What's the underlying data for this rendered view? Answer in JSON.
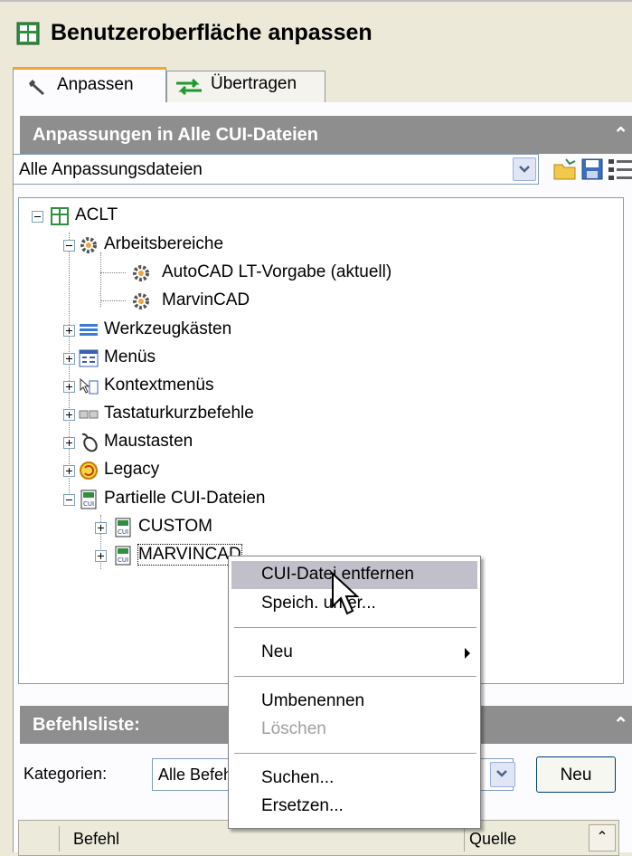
{
  "window": {
    "title": "Benutzeroberfläche anpassen"
  },
  "tabs": [
    {
      "label": "Anpassen",
      "active": true,
      "icon": "wrench-icon"
    },
    {
      "label": "Übertragen",
      "active": false,
      "icon": "transfer-arrows-icon"
    }
  ],
  "customizations": {
    "header": "Anpassungen in Alle CUI-Dateien",
    "file_filter": {
      "selected": "Alle Anpassungsdateien"
    },
    "tree": {
      "root": "ACLT",
      "workspaces": {
        "label": "Arbeitsbereiche",
        "children": [
          "AutoCAD LT-Vorgabe (aktuell)",
          "MarvinCAD"
        ]
      },
      "items": [
        {
          "label": "Werkzeugkästen",
          "icon": "toolbar-icon"
        },
        {
          "label": "Menüs",
          "icon": "menu-icon"
        },
        {
          "label": "Kontextmenüs",
          "icon": "context-menu-icon"
        },
        {
          "label": "Tastaturkurzbefehle",
          "icon": "keyboard-keys-icon"
        },
        {
          "label": "Maustasten",
          "icon": "mouse-icon"
        },
        {
          "label": "Legacy",
          "icon": "legacy-icon"
        }
      ],
      "partial": {
        "label": "Partielle CUI-Dateien",
        "children": [
          "CUSTOM",
          "MARVINCAD"
        ]
      }
    }
  },
  "command_list": {
    "header": "Befehlsliste:",
    "category_label": "Kategorien:",
    "category_value": "Alle Befehle",
    "new_button": "Neu",
    "columns": [
      "Befehl",
      "Quelle"
    ]
  },
  "context_menu": {
    "items": [
      {
        "label": "CUI-Datei entfernen",
        "highlighted": true
      },
      {
        "label": "Speich. unter..."
      },
      {
        "label": "Neu",
        "submenu": true
      },
      {
        "label": "Umbenennen"
      },
      {
        "label": "Löschen",
        "disabled": true
      },
      {
        "label": "Suchen..."
      },
      {
        "label": "Ersetzen..."
      }
    ]
  },
  "colors": {
    "section_header": "#8e8e8e",
    "tab_accent": "#f2a33a",
    "menu_highlight": "#c1bfc9"
  }
}
